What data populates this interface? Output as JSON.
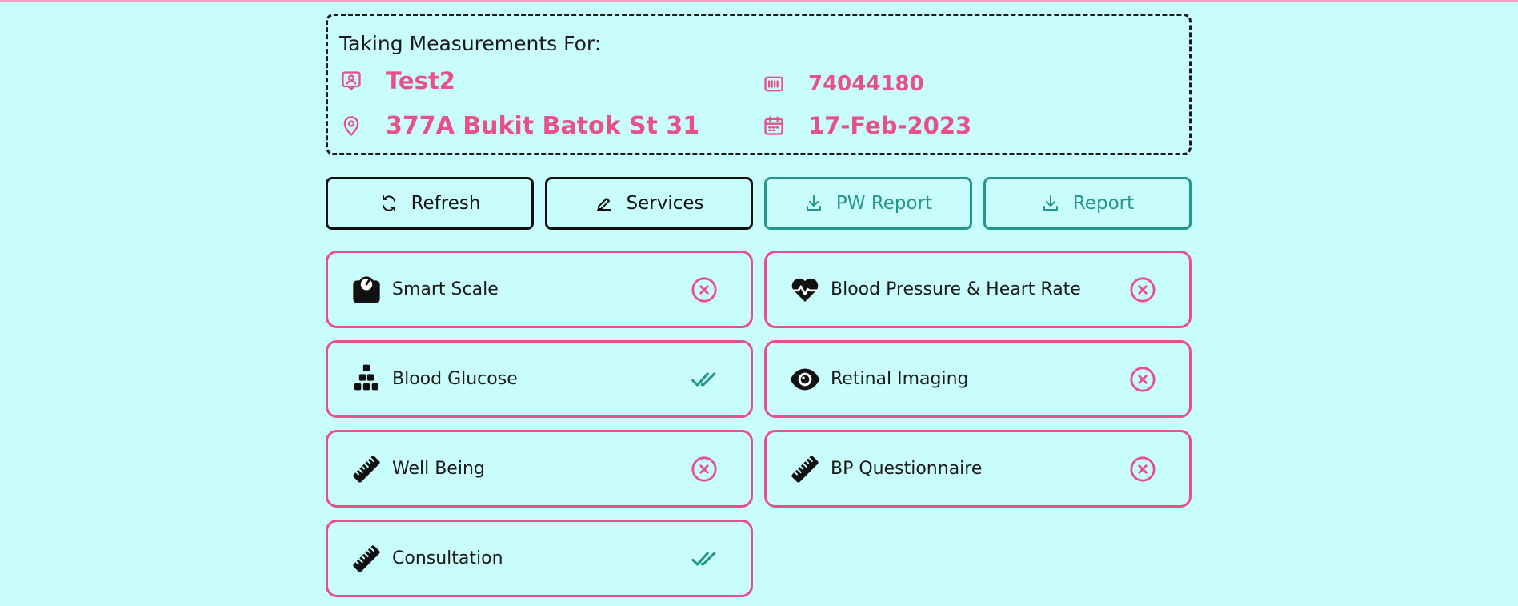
{
  "patient": {
    "heading": "Taking Measurements For:",
    "name": "Test2",
    "address": "377A Bukit Batok St 31",
    "id": "74044180",
    "date": "17-Feb-2023",
    "icons": {
      "name": "contact-card-icon",
      "address": "map-pin-icon",
      "id": "barcode-icon",
      "date": "calendar-icon"
    }
  },
  "actions": {
    "refresh": "Refresh",
    "services": "Services",
    "pw_report": "PW Report",
    "report": "Report"
  },
  "services": [
    {
      "label": "Smart Scale",
      "icon": "scale-icon",
      "status": "incomplete"
    },
    {
      "label": "Blood Pressure & Heart Rate",
      "icon": "heart-pulse-icon",
      "status": "incomplete"
    },
    {
      "label": "Blood Glucose",
      "icon": "cubes-icon",
      "status": "complete"
    },
    {
      "label": "Retinal Imaging",
      "icon": "eye-icon",
      "status": "incomplete"
    },
    {
      "label": "Well Being",
      "icon": "ruler-icon",
      "status": "incomplete"
    },
    {
      "label": "BP Questionnaire",
      "icon": "ruler-icon",
      "status": "incomplete"
    },
    {
      "label": "Consultation",
      "icon": "ruler-icon",
      "status": "complete"
    }
  ],
  "colors": {
    "accent": "#e8508a",
    "teal": "#26958c",
    "background": "#c8fdfb",
    "dark": "#111111"
  }
}
